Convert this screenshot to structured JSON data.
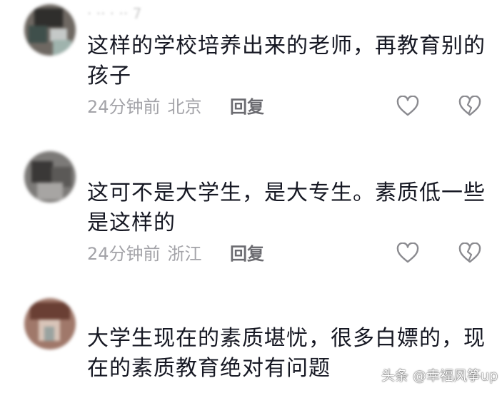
{
  "comments": [
    {
      "username": "· ·· · ·· 7",
      "text": "这样的学校培养出来的老师，再教育别的孩子",
      "time": "24分钟前",
      "location": "北京",
      "reply_label": "回复"
    },
    {
      "username": "",
      "text": "这可不是大学生，是大专生。素质低一些是这样的",
      "time": "24分钟前",
      "location": "浙江",
      "reply_label": "回复"
    },
    {
      "username": "",
      "text": "大学生现在的素质堪忧，很多白嫖的，现在的素质教育绝对有问题",
      "time": "",
      "location": "",
      "reply_label": ""
    }
  ],
  "watermark": "头条 @幸福风筝up",
  "icons": {
    "like": "heart-outline-icon",
    "dislike": "broken-heart-icon"
  },
  "colors": {
    "text": "#161823",
    "meta": "#a3a3a8",
    "reply": "#6b6b70",
    "icon": "#8a8a8f"
  }
}
